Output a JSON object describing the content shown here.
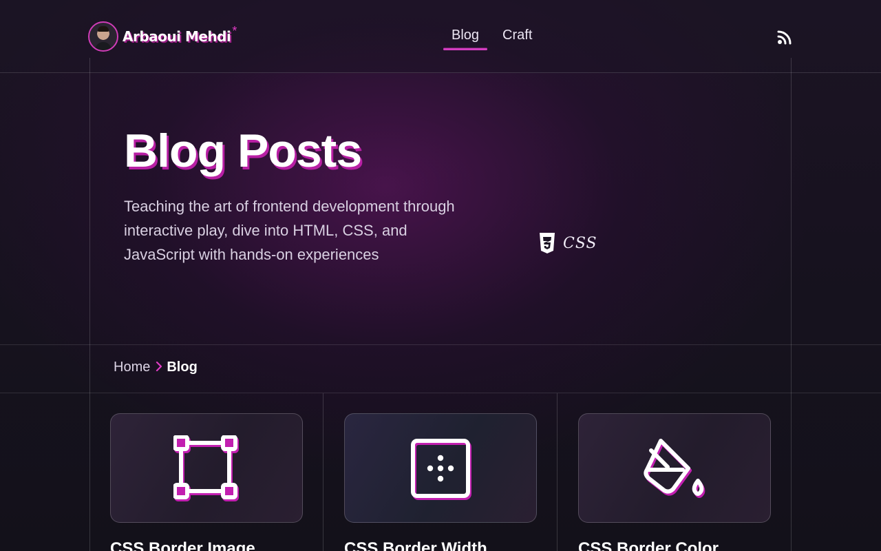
{
  "header": {
    "brand_name": "Arbaoui Mehdi",
    "brand_mark": "*",
    "nav": [
      {
        "label": "Blog",
        "active": true
      },
      {
        "label": "Craft",
        "active": false
      }
    ],
    "rss_icon": "rss-icon"
  },
  "hero": {
    "title": "Blog Posts",
    "description": "Teaching the art of frontend development through interactive play, dive into HTML, CSS, and JavaScript with hands-on experiences",
    "tag": {
      "label": "CSS",
      "icon": "css3-icon"
    }
  },
  "breadcrumb": {
    "home": "Home",
    "current": "Blog"
  },
  "posts": [
    {
      "title": "CSS Border Image",
      "icon": "border-image-icon"
    },
    {
      "title": "CSS Border Width",
      "icon": "border-width-icon"
    },
    {
      "title": "CSS Border Color",
      "icon": "paint-bucket-icon"
    }
  ],
  "colors": {
    "accent": "#d43cc0",
    "background": "#14111b",
    "text": "#f2eef8"
  }
}
